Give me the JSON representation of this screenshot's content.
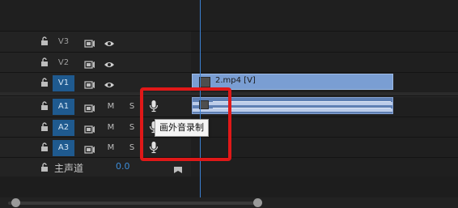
{
  "tracks": {
    "video": [
      {
        "name": "V3",
        "active": false
      },
      {
        "name": "V2",
        "active": false
      },
      {
        "name": "V1",
        "active": true
      }
    ],
    "audio": [
      {
        "name": "A1",
        "active": true,
        "m": "M",
        "s": "S"
      },
      {
        "name": "A2",
        "active": true,
        "m": "M",
        "s": "S"
      },
      {
        "name": "A3",
        "active": true,
        "m": "M",
        "s": "S"
      }
    ],
    "master": {
      "label": "主声道",
      "value": "0.0"
    }
  },
  "clips": {
    "video_title": "2.mp4 [V]"
  },
  "tooltip": {
    "text": "画外音录制"
  },
  "colors": {
    "accent": "#1f5a8f",
    "playhead": "#3b7fd0",
    "video_clip": "#7a9ed3",
    "audio_clip": "#5e7fb3",
    "highlight": "#e01818"
  }
}
